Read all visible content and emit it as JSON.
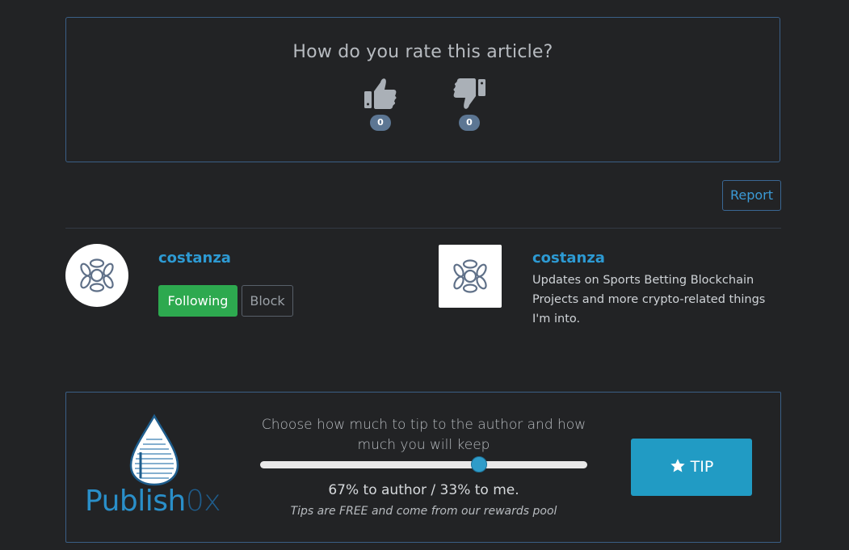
{
  "rating": {
    "title": "How do you rate this article?",
    "thumbs_up_icon": "thumbs-up-icon",
    "thumbs_down_icon": "thumbs-down-icon",
    "likes": "0",
    "dislikes": "0"
  },
  "report": {
    "label": "Report"
  },
  "author": {
    "name": "costanza",
    "follow_label": "Following",
    "block_label": "Block",
    "avatar_icon": "author-avatar-icon"
  },
  "publication": {
    "name": "costanza",
    "bio": "Updates on Sports Betting Blockchain Projects and more crypto-related things I'm into.",
    "avatar_icon": "publication-avatar-icon"
  },
  "tip": {
    "logo_text_main": "Publish",
    "logo_text_suffix": "0x",
    "description": "Choose how much to tip to the author and how much you will keep",
    "author_percent": 67,
    "split_text": "67% to author / 33% to me.",
    "note": "Tips are FREE and come from our rewards pool",
    "button_label": "TIP",
    "button_icon": "star-icon"
  },
  "colors": {
    "accent": "#2d9ad3",
    "follow_green": "#2da94f",
    "tip_button": "#219bc4",
    "card_border": "#3a5f86",
    "background": "#222325"
  }
}
